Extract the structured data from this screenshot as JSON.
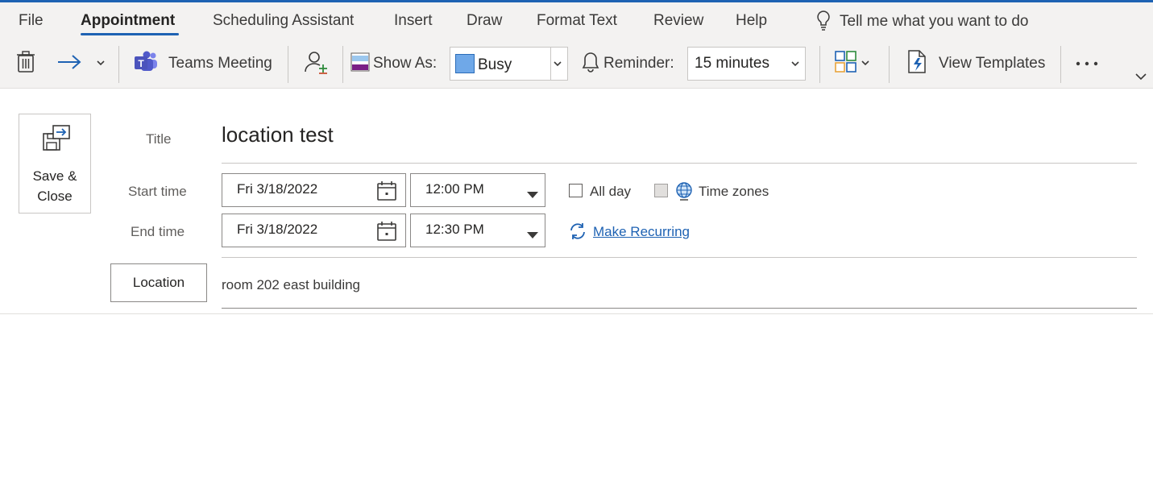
{
  "ribbon": {
    "tabs": [
      "File",
      "Appointment",
      "Scheduling Assistant",
      "Insert",
      "Draw",
      "Format Text",
      "Review",
      "Help"
    ],
    "active_tab": "Appointment",
    "tell_me": "Tell me what you want to do",
    "accent_color": "#1e62b3"
  },
  "toolbar": {
    "delete_icon": "trash-icon",
    "forward_icon": "forward-arrow-icon",
    "teams_meeting_label": "Teams Meeting",
    "invite_icon": "invite-attendees-icon",
    "show_as_label": "Show As:",
    "show_as_value": "Busy",
    "busy_color": "#6fa8e8",
    "reminder_label": "Reminder:",
    "reminder_value": "15 minutes",
    "categorize_icon": "categorize-icon",
    "view_templates_label": "View Templates",
    "more_icon": "more-options-icon",
    "collapse_icon": "chevron-down-icon"
  },
  "form": {
    "save_close_line1": "Save &",
    "save_close_line2": "Close",
    "title_label": "Title",
    "title_value": "location test",
    "start_time_label": "Start time",
    "start_date": "Fri 3/18/2022",
    "start_time": "12:00 PM",
    "end_time_label": "End time",
    "end_date": "Fri 3/18/2022",
    "end_time": "12:30 PM",
    "all_day_label": "All day",
    "all_day_checked": false,
    "time_zones_label": "Time zones",
    "make_recurring_label": "Make Recurring",
    "location_button": "Location",
    "location_value": "room 202 east building"
  }
}
